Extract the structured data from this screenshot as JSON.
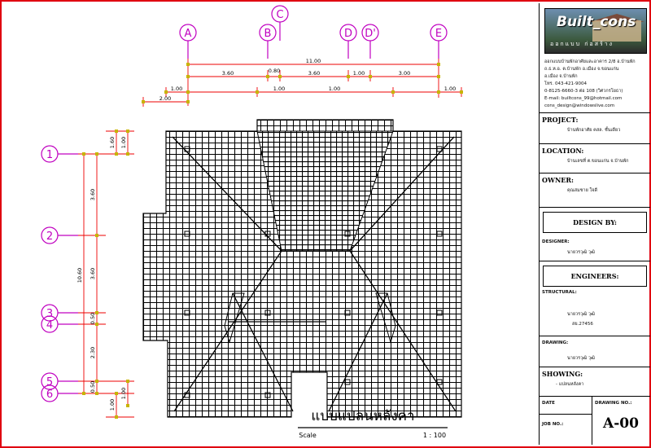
{
  "grid_columns": [
    "A",
    "B",
    "C",
    "D",
    "D'",
    "E"
  ],
  "grid_rows": [
    "1",
    "2",
    "3",
    "4",
    "5",
    "6"
  ],
  "dims_top": {
    "overall": "11.00",
    "c_offset": "0.80",
    "bays": [
      "3.60",
      "3.60",
      "1.00",
      "3.00"
    ],
    "overhangs": [
      "1.00",
      "1.00",
      "1.00",
      "1.00"
    ],
    "left_overhang": "2.00"
  },
  "dims_left": {
    "overall": "10.60",
    "bays": [
      "3.60",
      "3.60",
      "0.50",
      "2.30",
      "0.50"
    ],
    "overhang_top": "1.60",
    "overhang_top_inner": "1.00",
    "overhang_bottom": "1.00",
    "overhang_bottom_inner": "1.00"
  },
  "drawing_title": "แบบแปลนหลังคา",
  "scale_label": "Scale",
  "scale_value": "1 : 100",
  "title_block": {
    "logo_text": "Built_cons",
    "logo_sub": "ออกแบบ ก่อสร้าง",
    "address_lines": [
      "ออกแบบบ้านพักอาศัยและอาคาร 2/8 อ.บ้านพัก",
      "ถ.ธ.ห.อ. ต.บ้านพัก อ.เมือง จ.ขอนแก่น",
      "อ.เมือง จ.บ้านพัก",
      "โทร. 043-421-9004",
      "0-8125-6660-3 ต่อ 108 (วิศวกรโยธา)",
      "E-mail: builtcons_99@hotmail.com",
      "cons_design@windowslive.com"
    ],
    "project_label": "PROJECT:",
    "project_value": "บ้านพักอาศัย คสล. ชั้นเดียว",
    "location_label": "LOCATION:",
    "location_value": "บ้านเลขที่ ต.ขอนแก่น จ.บ้านพัก",
    "owner_label": "OWNER:",
    "owner_value": "คุณสมชาย  ใจดี",
    "design_by_label": "DESIGN BY:",
    "designer_label": "DESIGNER:",
    "designer_value": "นายวรวุฒิ  วุฒิ",
    "engineers_label": "ENGINEERS:",
    "structural_label": "STRUCTURAL:",
    "structural_value": "นายวรวุฒิ  วุฒิ",
    "license_value": "สย.27456",
    "drawing_label": "DRAWING:",
    "drawing_value": "นายวรวุฒิ  วุฒิ",
    "showing_label": "SHOWING:",
    "showing_value": "- แปลนหลังคา",
    "date_label": "DATE",
    "drawing_no_label": "DRAWING NO.:",
    "job_no_label": "JOB NO.:",
    "sheet_number": "A-00"
  }
}
